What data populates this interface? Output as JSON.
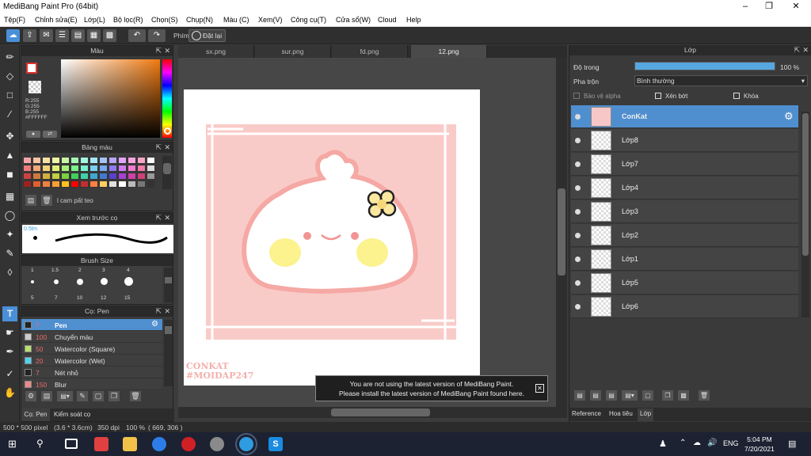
{
  "window": {
    "title": "MediBang Paint Pro (64bit)"
  },
  "menu": [
    "Tệp(F)",
    "Chỉnh sửa(E)",
    "Lớp(L)",
    "Bộ lọc(R)",
    "Chọn(S)",
    "Chụp(N)",
    "Màu (C)",
    "Xem(V)",
    "Công cụ(T)",
    "Cửa sổ(W)",
    "Cloud",
    "Help"
  ],
  "toolbar": {
    "shortcut_label": "Phím",
    "reset_label": "Đặt lại"
  },
  "color_panel": {
    "title": "Màu",
    "rgb": [
      "R:255",
      "G:255",
      "B:255"
    ],
    "hex": "#FFFFFF"
  },
  "palette_panel": {
    "title": "Bảng màu",
    "footer": "l cam pất teo"
  },
  "brush_preview_panel": {
    "title": "Xem trước cọ",
    "size": "0.5lm"
  },
  "brush_size_panel": {
    "title": "Brush Size",
    "top_labels": [
      "1",
      "1.5",
      "2",
      "3",
      "4"
    ],
    "bottom_labels": [
      "5",
      "7",
      "10",
      "12",
      "15"
    ]
  },
  "brush_panel": {
    "title": "Cọ: Pen",
    "items": [
      {
        "size": "7",
        "name": "Pen",
        "color": "#222222",
        "selected": true
      },
      {
        "size": "100",
        "name": "Chuyển màu",
        "color": "#cccccc",
        "selected": false
      },
      {
        "size": "50",
        "name": "Watercolor (Square)",
        "color": "#b8e06a",
        "selected": false
      },
      {
        "size": "20",
        "name": "Watercolor (Wet)",
        "color": "#4fd4f0",
        "selected": false
      },
      {
        "size": "7",
        "name": "Nét nhỏ",
        "color": "#222222",
        "selected": false
      },
      {
        "size": "150",
        "name": "Blur",
        "color": "#ee8888",
        "selected": false
      }
    ],
    "footer_tabs": [
      "Cọ: Pen",
      "Kiểm soát cọ"
    ]
  },
  "tabs": [
    "sx.png",
    "sur.png",
    "fd.png",
    "12.png"
  ],
  "artwork": {
    "caption_line1": "CONKAT",
    "caption_line2": "#MOIDAP247"
  },
  "toast": {
    "line1": "You are not using the latest version of MediBang Paint.",
    "line2": "Please install the latest version of MediBang Paint found here."
  },
  "layer_panel": {
    "title": "Lớp",
    "opacity_label": "Độ trong",
    "opacity_value": "100 %",
    "opacity_fraction": 1.0,
    "blend_label": "Pha trộn",
    "blend_value": "Bình thường",
    "protect_alpha": "Bảo vệ alpha",
    "clipping": "Xén bớt",
    "lock": "Khóa",
    "layers": [
      "ConKat",
      "Lớp8",
      "Lớp7",
      "Lớp4",
      "Lớp3",
      "Lớp2",
      "Lớp1",
      "Lớp5",
      "Lớp6"
    ],
    "footer_tabs": [
      "Reference",
      "Hoa tiêu",
      "Lớp"
    ]
  },
  "status": {
    "size": "500 * 500 pixel",
    "dims": "(3.6 * 3.6cm)",
    "dpi": "350 dpi",
    "zoom": "100 %",
    "coords": "( 669, 306 )"
  },
  "taskbar": {
    "lang": "ENG",
    "time": "5:04 PM",
    "date": "7/20/2021"
  }
}
